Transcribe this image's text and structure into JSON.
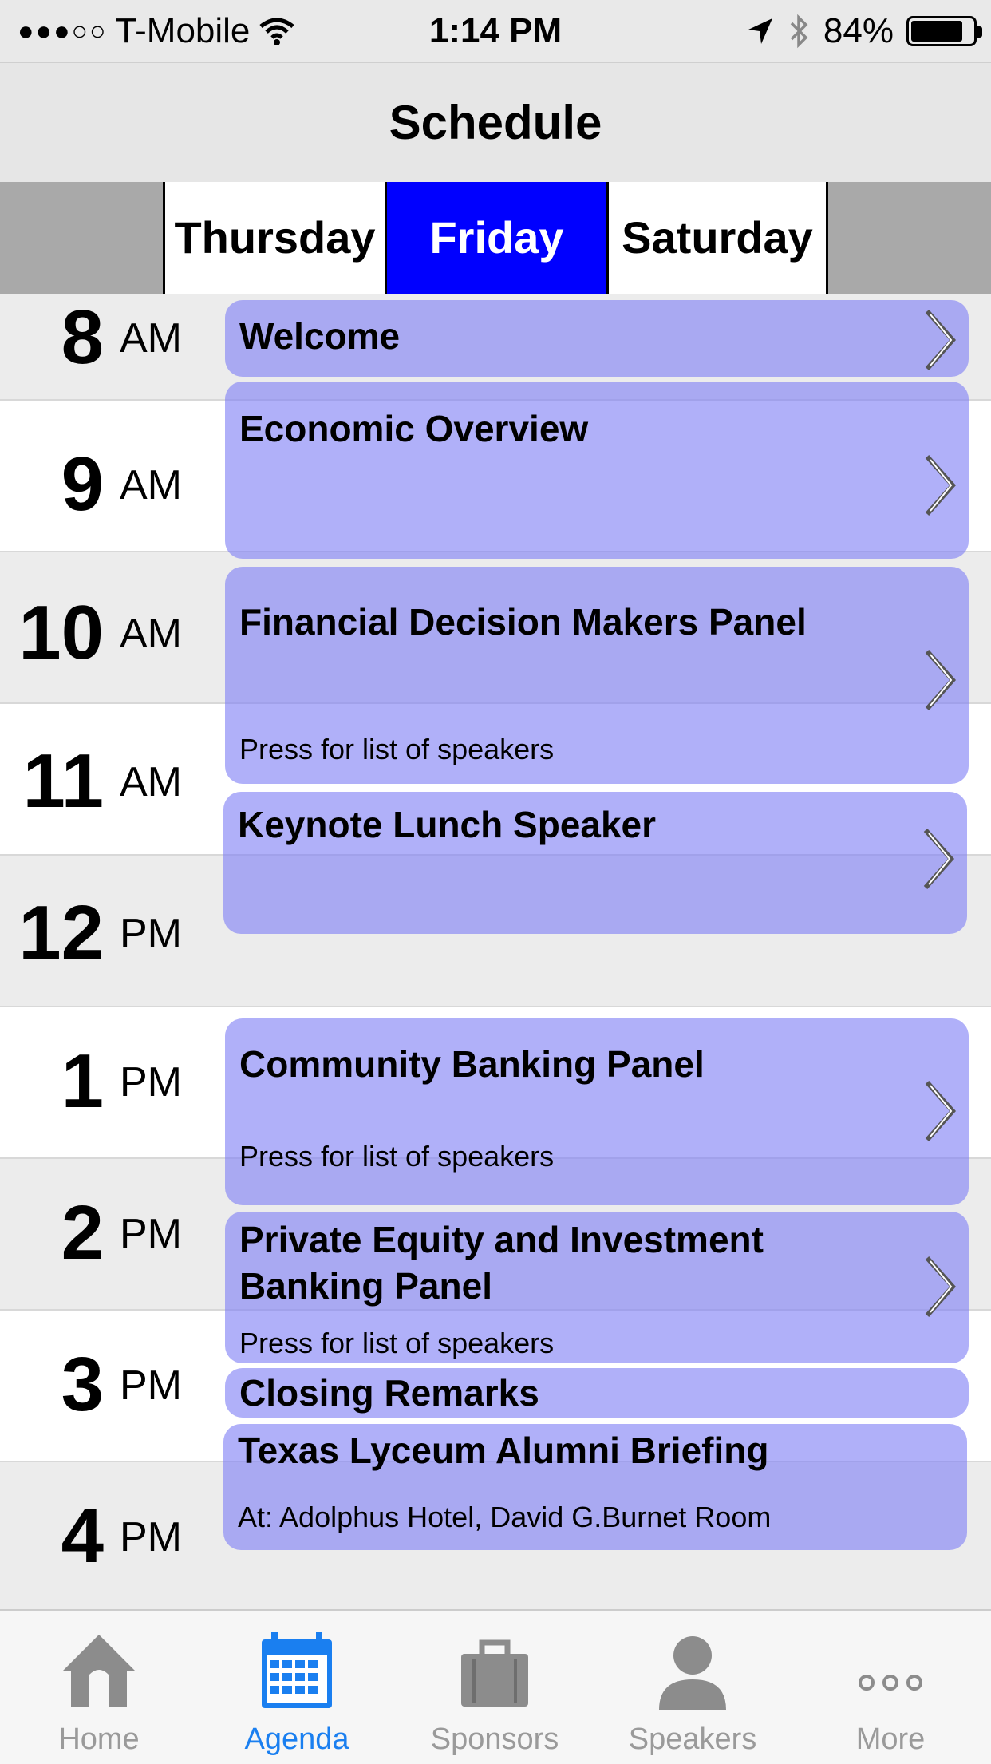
{
  "status_bar": {
    "signal": "●●●○○",
    "carrier": "T-Mobile",
    "time": "1:14 PM",
    "battery": "84%",
    "battery_level": 0.84
  },
  "nav": {
    "title": "Schedule"
  },
  "day_tabs": [
    {
      "label": "Thursday",
      "selected": false
    },
    {
      "label": "Friday",
      "selected": true
    },
    {
      "label": "Saturday",
      "selected": false
    }
  ],
  "hours": [
    {
      "num": "8",
      "ampm": "AM"
    },
    {
      "num": "9",
      "ampm": "AM"
    },
    {
      "num": "10",
      "ampm": "AM"
    },
    {
      "num": "11",
      "ampm": "AM"
    },
    {
      "num": "12",
      "ampm": "PM"
    },
    {
      "num": "1",
      "ampm": "PM"
    },
    {
      "num": "2",
      "ampm": "PM"
    },
    {
      "num": "3",
      "ampm": "PM"
    },
    {
      "num": "4",
      "ampm": "PM"
    }
  ],
  "events": [
    {
      "title": "Welcome",
      "subtitle": ""
    },
    {
      "title": "Economic Overview",
      "subtitle": ""
    },
    {
      "title": "Financial Decision Makers Panel",
      "subtitle": "Press for list of speakers"
    },
    {
      "title": "Keynote Lunch Speaker",
      "subtitle": ""
    },
    {
      "title": "Community Banking Panel",
      "subtitle": "Press for list of speakers"
    },
    {
      "title": "Private Equity and Investment Banking Panel",
      "subtitle": "Press for list of speakers"
    },
    {
      "title": "Closing Remarks",
      "subtitle": ""
    },
    {
      "title": "Texas Lyceum Alumni Briefing",
      "subtitle": "At: Adolphus Hotel, David G.Burnet Room"
    }
  ],
  "tab_bar": [
    {
      "label": "Home",
      "icon": "home-icon",
      "selected": false
    },
    {
      "label": "Agenda",
      "icon": "calendar-icon",
      "selected": true
    },
    {
      "label": "Sponsors",
      "icon": "briefcase-icon",
      "selected": false
    },
    {
      "label": "Speakers",
      "icon": "person-icon",
      "selected": false
    },
    {
      "label": "More",
      "icon": "more-icon",
      "selected": false
    }
  ],
  "colors": {
    "selected_day": "#0000ff",
    "event_fill": "#8080f5",
    "tab_active": "#1a7ff0",
    "tab_inactive": "#9a9a9a"
  }
}
